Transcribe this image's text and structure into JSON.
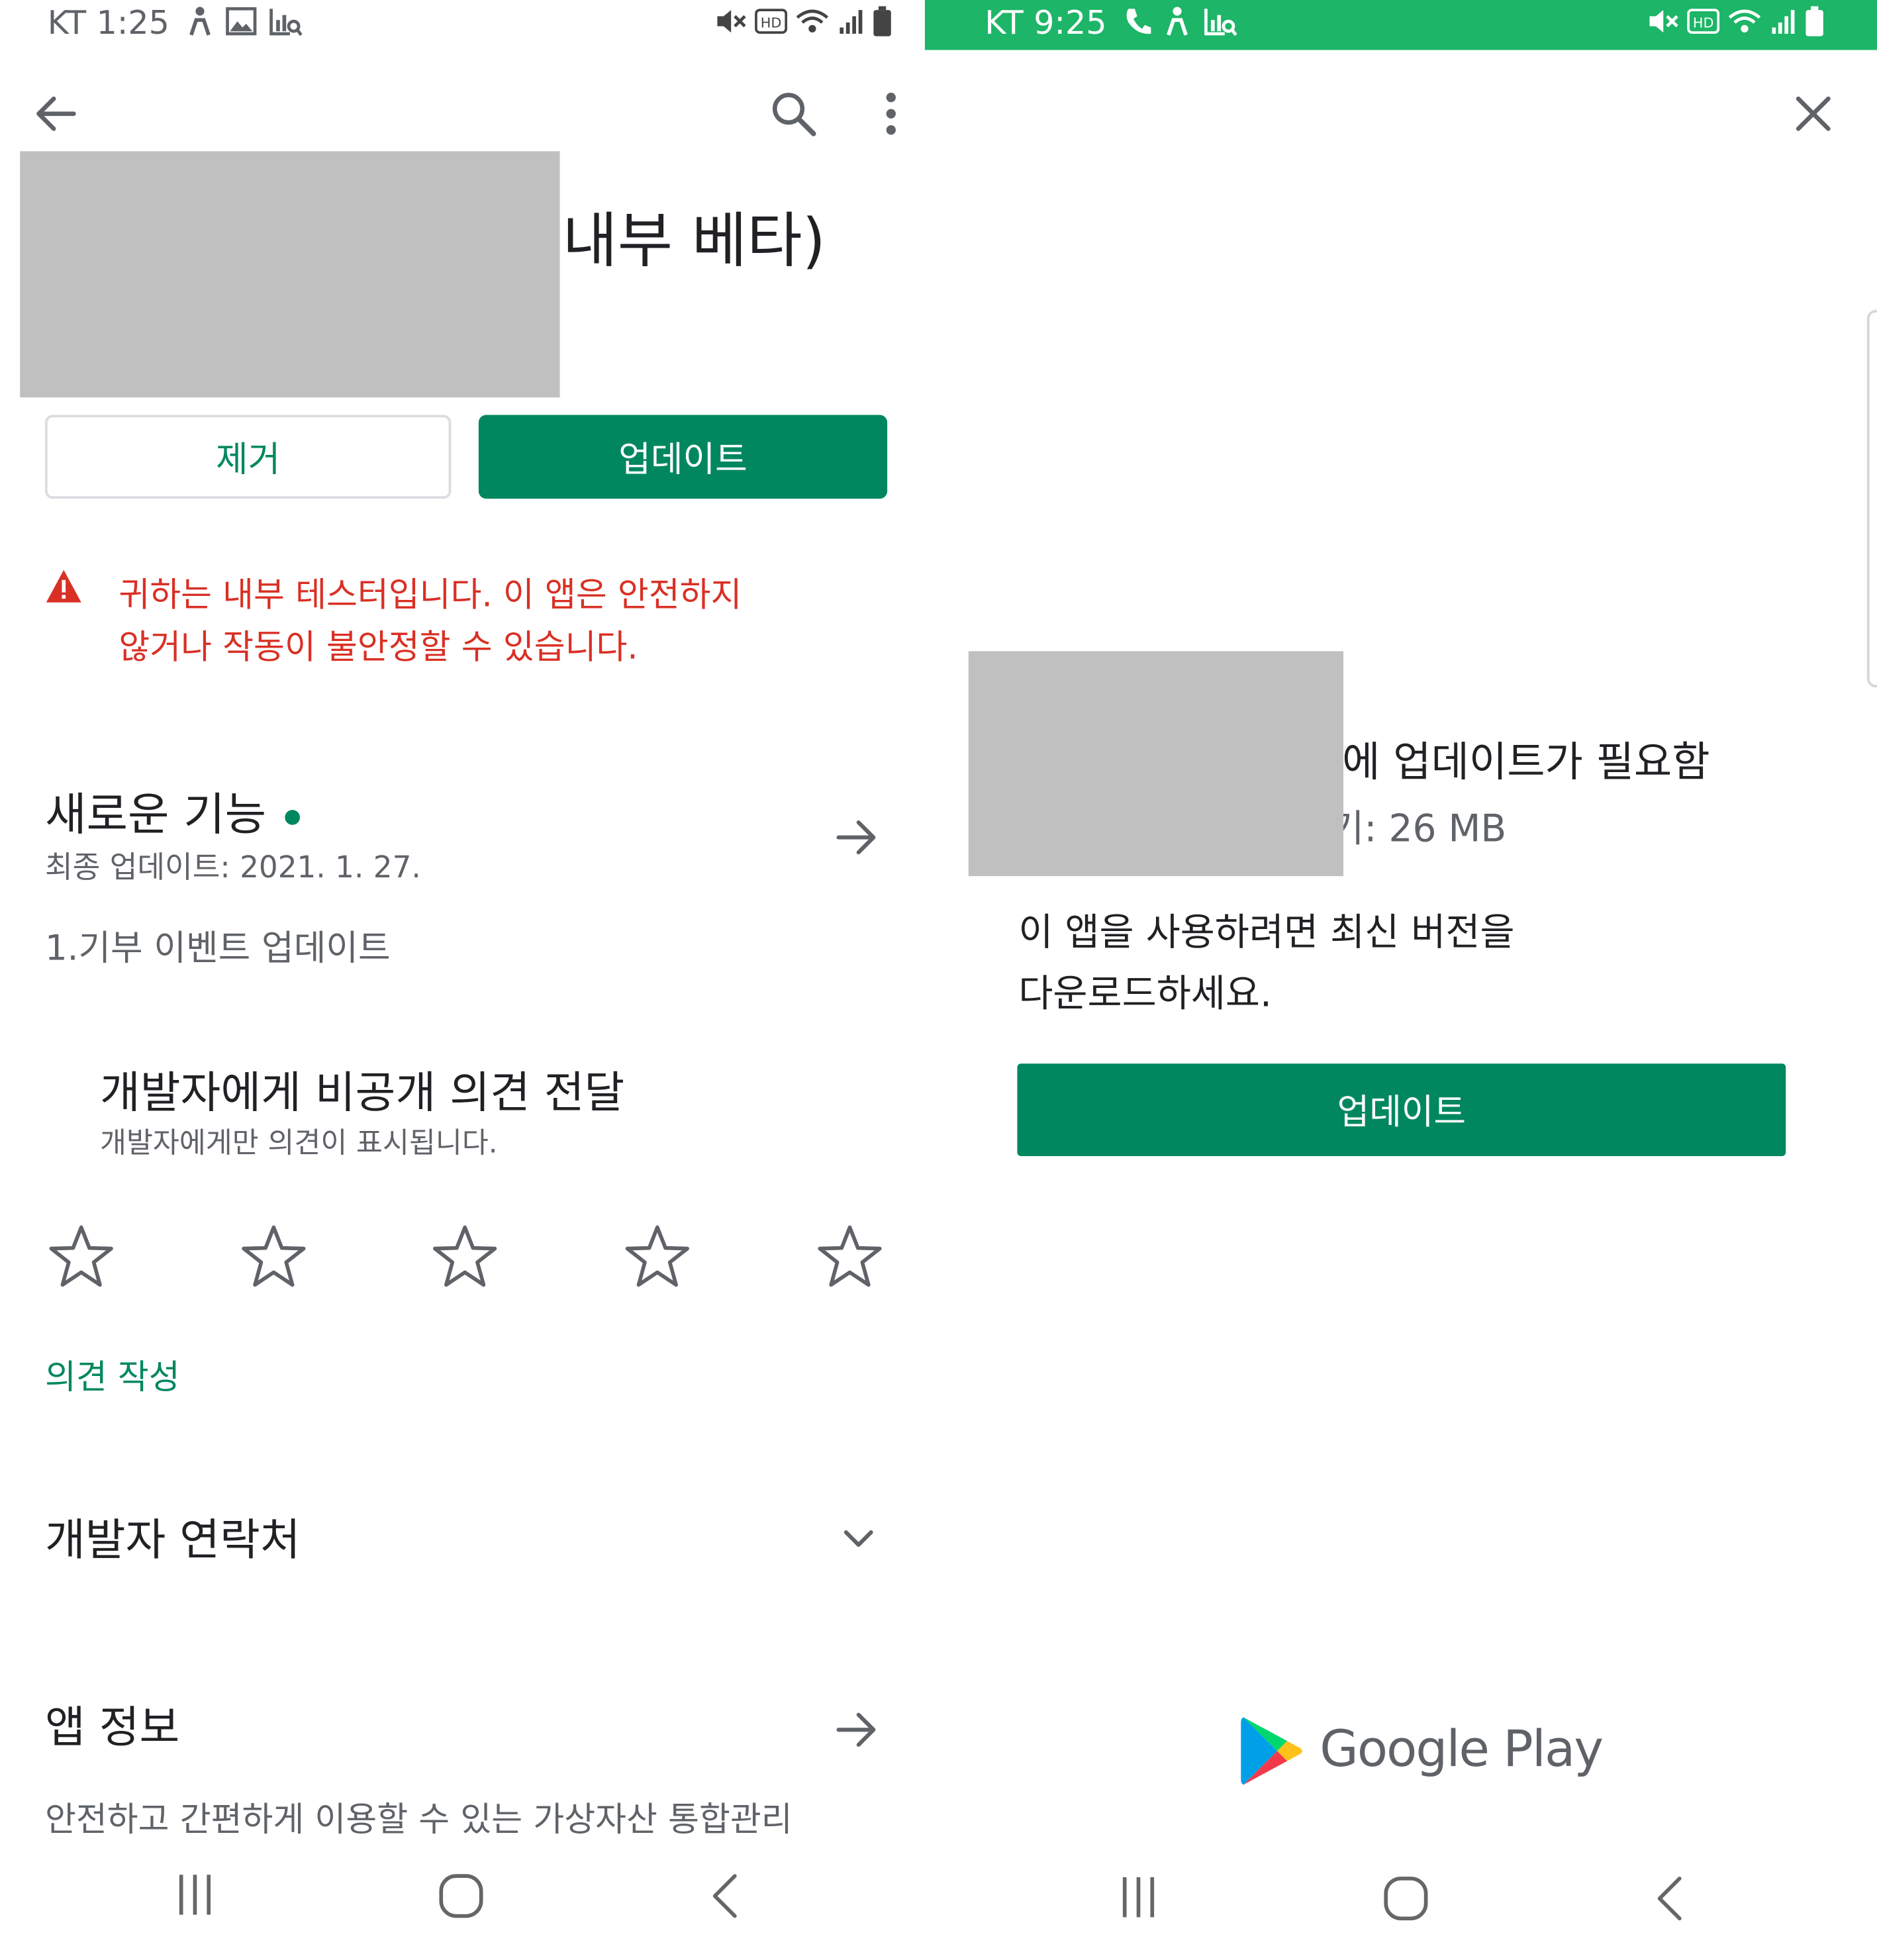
{
  "colors": {
    "accent": "#01875f",
    "warning": "#d93025",
    "status_bar_right": "#1db567",
    "text_primary": "#202124",
    "text_secondary": "#5f6368"
  },
  "left": {
    "status_bar": {
      "carrier_time": "KT 1:25"
    },
    "toolbar": {
      "back_icon": "arrow-left-icon",
      "search_icon": "search-icon",
      "menu_icon": "more-vert-icon"
    },
    "app_title_visible": "내부 베타)",
    "buttons": {
      "uninstall": "제거",
      "update": "업데이트"
    },
    "warning": {
      "icon": "warning-triangle-icon",
      "line1": "귀하는 내부 테스터입니다. 이 앱은 안전하지",
      "line2": "않거나 작동이 불안정할 수 있습니다."
    },
    "whats_new": {
      "title": "새로운 기능",
      "updated": "최종 업데이트: 2021. 1. 27.",
      "body": "1.기부 이벤트 업데이트"
    },
    "feedback": {
      "title": "개발자에게 비공개 의견 전달",
      "subtitle": "개발자에게만 의견이 표시됩니다.",
      "stars_total": 5,
      "stars_filled": 0,
      "write_link": "의견 작성"
    },
    "developer_contact": {
      "title": "개발자 연락처"
    },
    "app_info": {
      "title": "앱 정보",
      "body": "안전하고 간편하게 이용할 수 있는 가상자산 통합관리"
    }
  },
  "right": {
    "status_bar": {
      "carrier_time": "KT 9:25"
    },
    "close_icon": "close-icon",
    "dialog": {
      "title_visible": "에 업데이트가 필요함",
      "size_visible": "기: 26 MB",
      "message_line1": "이 앱을 사용하려면 최신 버전을",
      "message_line2": "다운로드하세요.",
      "update_button": "업데이트"
    },
    "brand": {
      "name": "Google Play"
    }
  }
}
